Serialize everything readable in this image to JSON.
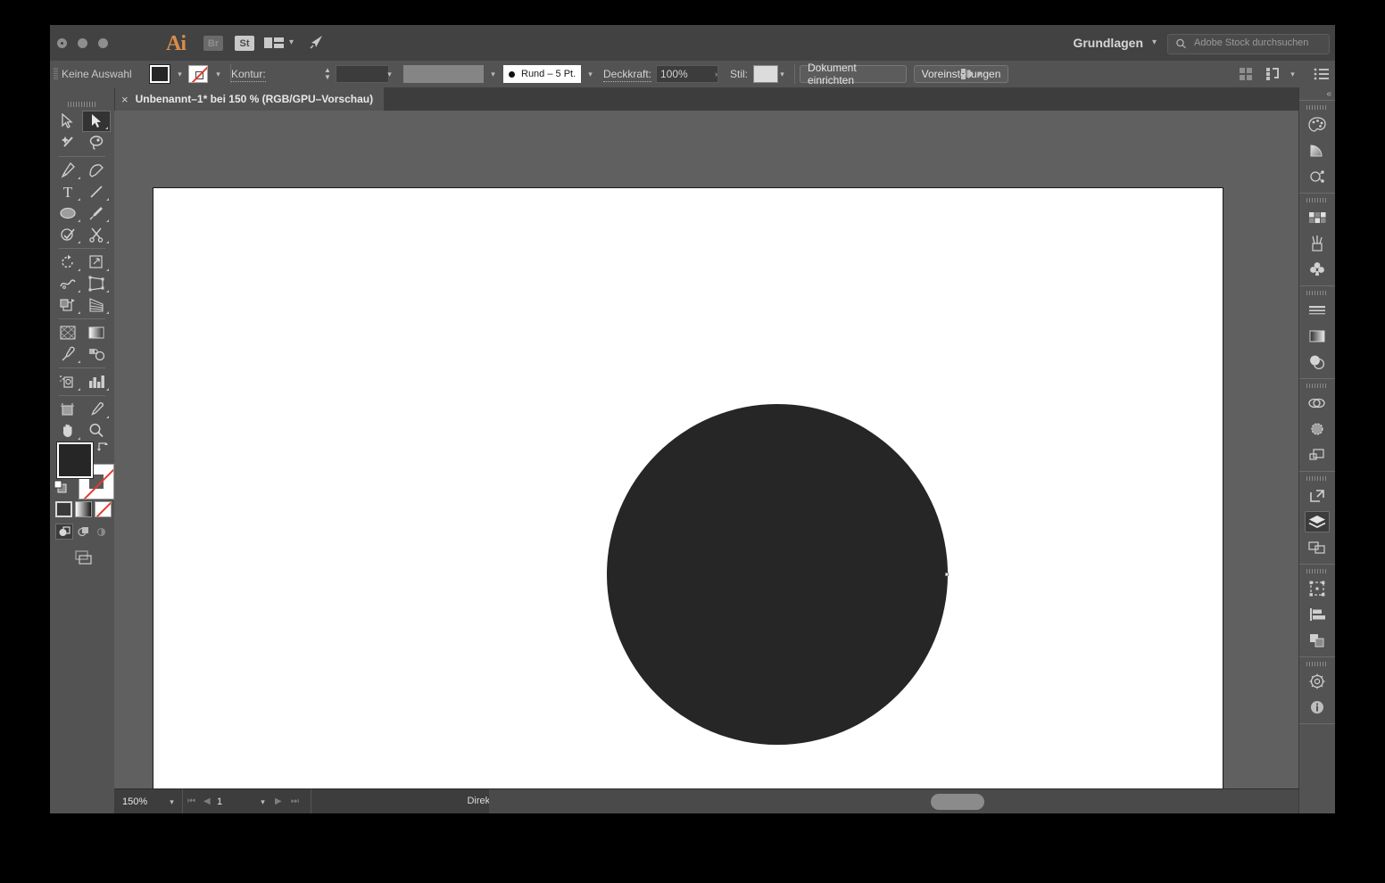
{
  "window": {
    "title_icons": [
      "ai-logo",
      "bridge-badge",
      "stock-badge",
      "arrange-documents-icon",
      "chevron-down-icon",
      "rocket-icon"
    ],
    "ai_logo_text": "Ai",
    "bridge_badge_text": "Br",
    "stock_badge_text": "St",
    "workspace_name": "Grundlagen",
    "search_placeholder": "Adobe Stock durchsuchen"
  },
  "control_bar": {
    "selection_status": "Keine Auswahl",
    "fill_label": "fill-swatch",
    "stroke_label": "stroke-swatch",
    "kontur_label": "Kontur:",
    "stroke_weight_value": "",
    "variable_width_value": "",
    "brush_profile": "Rund – 5 Pt.",
    "opacity_label": "Deckkraft:",
    "opacity_value": "100%",
    "style_label": "Stil:",
    "document_setup_button": "Dokument einrichten",
    "preferences_button": "Voreinstellungen",
    "right_icons": [
      "select-similar-icon",
      "chevron-down-icon",
      "align-grid-icon",
      "arrange-icon",
      "chevron-down-icon",
      "list-icon"
    ]
  },
  "document_tab": {
    "close_label": "×",
    "title": "Unbenannt–1* bei 150 % (RGB/GPU–Vorschau)"
  },
  "toolbar": {
    "collapse_label": "«",
    "tools": [
      {
        "name": "selection-tool",
        "selected": false,
        "corner": false
      },
      {
        "name": "direct-selection-tool",
        "selected": true,
        "corner": true
      },
      {
        "name": "magic-wand-tool",
        "selected": false,
        "corner": false
      },
      {
        "name": "lasso-tool",
        "selected": false,
        "corner": false
      },
      {
        "name": "pen-tool",
        "selected": false,
        "corner": true
      },
      {
        "name": "curvature-tool",
        "selected": false,
        "corner": false
      },
      {
        "name": "type-tool",
        "selected": false,
        "corner": true
      },
      {
        "name": "line-segment-tool",
        "selected": false,
        "corner": true
      },
      {
        "name": "ellipse-tool",
        "selected": false,
        "corner": true
      },
      {
        "name": "paintbrush-tool",
        "selected": false,
        "corner": true
      },
      {
        "name": "shaper-tool",
        "selected": false,
        "corner": true
      },
      {
        "name": "scissors-tool",
        "selected": false,
        "corner": true
      },
      {
        "name": "rotate-tool",
        "selected": false,
        "corner": true
      },
      {
        "name": "scale-tool",
        "selected": false,
        "corner": true
      },
      {
        "name": "width-tool",
        "selected": false,
        "corner": true
      },
      {
        "name": "free-transform-tool",
        "selected": false,
        "corner": true
      },
      {
        "name": "shape-builder-tool",
        "selected": false,
        "corner": true
      },
      {
        "name": "perspective-grid-tool",
        "selected": false,
        "corner": true
      },
      {
        "name": "mesh-tool",
        "selected": false,
        "corner": false
      },
      {
        "name": "gradient-tool",
        "selected": false,
        "corner": false
      },
      {
        "name": "eyedropper-tool",
        "selected": false,
        "corner": true
      },
      {
        "name": "blend-tool",
        "selected": false,
        "corner": false
      },
      {
        "name": "symbol-sprayer-tool",
        "selected": false,
        "corner": true
      },
      {
        "name": "column-graph-tool",
        "selected": false,
        "corner": true
      },
      {
        "name": "artboard-tool",
        "selected": false,
        "corner": false
      },
      {
        "name": "slice-tool",
        "selected": false,
        "corner": true
      },
      {
        "name": "hand-tool",
        "selected": false,
        "corner": true
      },
      {
        "name": "zoom-tool",
        "selected": false,
        "corner": false
      }
    ],
    "fill_color": "#262626",
    "stroke_color": "none",
    "color_modes": [
      "color-swatch",
      "gradient-swatch",
      "none-swatch"
    ],
    "draw_modes": [
      "draw-normal",
      "draw-behind",
      "draw-inside"
    ],
    "draw_mode_active": "draw-normal",
    "screen_mode": "screen-mode-icon"
  },
  "canvas": {
    "artboard_background": "#ffffff",
    "canvas_background": "#606060",
    "shape": {
      "name": "ellipse",
      "fill": "#262626",
      "stroke": "none"
    },
    "anchor_point_visible": true
  },
  "status_bar": {
    "zoom_level": "150%",
    "page_number": "1",
    "current_tool": "Direktauswahl",
    "nav_first": "⏮",
    "nav_prev": "◀",
    "nav_next": "▶",
    "nav_last": "⏭"
  },
  "panel_dock": {
    "collapse_label": "«",
    "groups": [
      {
        "icons": [
          "color-panel-icon",
          "color-guide-icon",
          "color-themes-icon"
        ]
      },
      {
        "icons": [
          "swatches-panel-icon",
          "brushes-panel-icon",
          "symbols-panel-icon"
        ]
      },
      {
        "icons": [
          "stroke-panel-icon",
          "gradient-panel-icon",
          "transparency-panel-icon"
        ]
      },
      {
        "icons": [
          "appearance-panel-icon",
          "graphic-styles-panel-icon",
          "image-trace-panel-icon"
        ]
      },
      {
        "icons": [
          "asset-export-panel-icon",
          "layers-panel-icon",
          "artboards-panel-icon"
        ]
      },
      {
        "icons": [
          "transform-panel-icon",
          "align-panel-icon",
          "pathfinder-panel-icon"
        ]
      },
      {
        "icons": [
          "navigator-panel-icon",
          "document-info-panel-icon"
        ]
      }
    ],
    "active_icon": "layers-panel-icon"
  },
  "colors": {
    "chrome": "#535353",
    "titlebar": "#424242",
    "canvas": "#606060",
    "accent": "#d98c4a",
    "text": "#d2d2d2",
    "shape_fill": "#262626"
  }
}
